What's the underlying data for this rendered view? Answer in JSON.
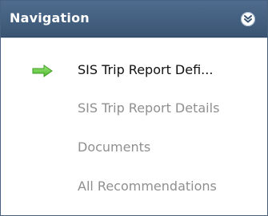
{
  "panel": {
    "title": "Navigation",
    "collapse_icon": "double-chevron-down-icon"
  },
  "nav_items": [
    {
      "label": "SIS Trip Report Defi...",
      "current": true,
      "icon": "green-arrow-right-icon"
    },
    {
      "label": "SIS Trip Report Details",
      "current": false
    },
    {
      "label": "Documents",
      "current": false
    },
    {
      "label": "All Recommendations",
      "current": false
    }
  ],
  "colors": {
    "header": "#44607f",
    "current_arrow": "#6fcf4a",
    "disabled_text": "#8f8f8f"
  }
}
